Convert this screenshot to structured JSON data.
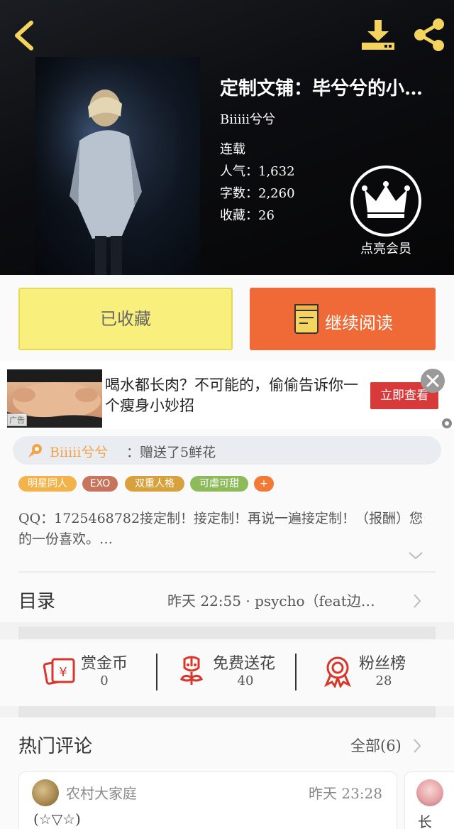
{
  "book": {
    "title": "定制文铺：毕兮兮的小…",
    "author": "Biiiii兮兮",
    "status": "连载",
    "popularity": "人气：1,632",
    "word_count": "字数：2,260",
    "favorites": "收藏：26"
  },
  "vip": {
    "label": "点亮会员"
  },
  "actions": {
    "collected_label": "已收藏",
    "read_label": "继续阅读"
  },
  "ad": {
    "text": "喝水都长肉？不可能的，偷偷告诉你一个瘦身小妙招",
    "tag": "广告",
    "cta": "立即查看"
  },
  "gift": {
    "user": "Biiiii兮兮",
    "text": "：赠送了5鲜花"
  },
  "tags": [
    {
      "label": "明星同人",
      "color": "#f2b34a"
    },
    {
      "label": "EXO",
      "color": "#c8735b"
    },
    {
      "label": "双重人格",
      "color": "#d7a23d"
    },
    {
      "label": "可虐可甜",
      "color": "#8dbb5a"
    },
    {
      "label": "+",
      "color": "#f07a36"
    }
  ],
  "description": "QQ：1725468782接定制！接定制！再说一遍接定制！（报酬）您的一份喜欢。…",
  "catalog": {
    "label": "目录",
    "latest": "昨天 22:55 · psycho（feat边…"
  },
  "stats": [
    {
      "label": "赏金币",
      "value": "0",
      "icon": "money-envelope-icon"
    },
    {
      "label": "免费送花",
      "value": "40",
      "icon": "flower-icon"
    },
    {
      "label": "粉丝榜",
      "value": "28",
      "icon": "medal-icon"
    }
  ],
  "comments": {
    "title": "热门评论",
    "all": "全部(6)",
    "items": [
      {
        "user": "农村大家庭",
        "time": "昨天 23:28",
        "text": "(☆▽☆)"
      },
      {
        "text": "长"
      }
    ]
  },
  "colors": {
    "accent_yellow": "#f9ef7d",
    "accent_orange": "#ef6a37",
    "icon_yellow": "#f4d35e",
    "stat_red": "#d9362b"
  }
}
